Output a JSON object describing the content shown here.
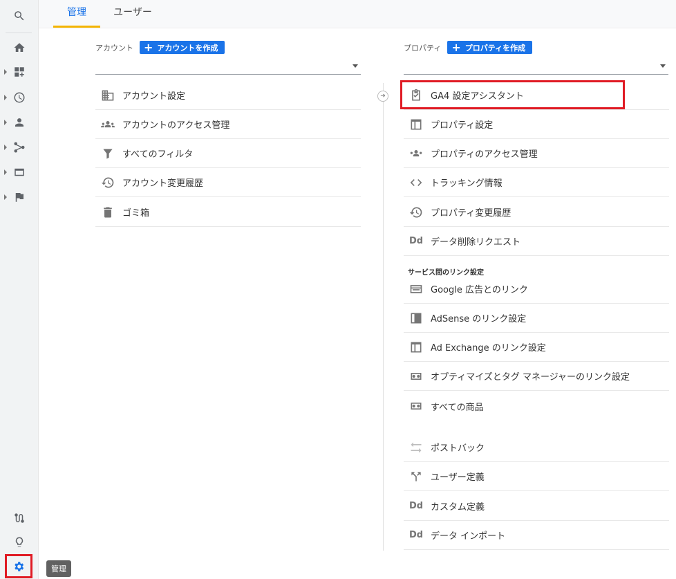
{
  "tabs": [
    {
      "label": "管理",
      "active": true
    },
    {
      "label": "ユーザー",
      "active": false
    }
  ],
  "tooltip": "管理",
  "account": {
    "header_label": "アカウント",
    "create_button": "アカウントを作成",
    "select_value": "",
    "items": [
      {
        "label": "アカウント設定",
        "icon": "building-icon"
      },
      {
        "label": "アカウントのアクセス管理",
        "icon": "people-icon"
      },
      {
        "label": "すべてのフィルタ",
        "icon": "filter-icon"
      },
      {
        "label": "アカウント変更履歴",
        "icon": "history-icon"
      },
      {
        "label": "ゴミ箱",
        "icon": "trash-icon"
      }
    ]
  },
  "property": {
    "header_label": "プロパティ",
    "create_button": "プロパティを作成",
    "select_value": "",
    "items": [
      {
        "label": "GA4 設定アシスタント",
        "icon": "clipboard-check-icon"
      },
      {
        "label": "プロパティ設定",
        "icon": "window-icon"
      },
      {
        "label": "プロパティのアクセス管理",
        "icon": "people-icon"
      },
      {
        "label": "トラッキング情報",
        "icon": "code-icon"
      },
      {
        "label": "プロパティ変更履歴",
        "icon": "history-icon"
      },
      {
        "label": "データ削除リクエスト",
        "icon": "dd-icon",
        "glyph": "Dd"
      }
    ],
    "links_section_title": "サービス間のリンク設定",
    "links": [
      {
        "label": "Google 広告とのリンク",
        "icon": "ads-icon"
      },
      {
        "label": "AdSense のリンク設定",
        "icon": "adsense-icon"
      },
      {
        "label": "Ad Exchange のリンク設定",
        "icon": "window-icon"
      },
      {
        "label": "オプティマイズとタグ マネージャーのリンク設定",
        "icon": "link-icon"
      },
      {
        "label": "すべての商品",
        "icon": "link-icon"
      }
    ],
    "other": [
      {
        "label": "ポストバック",
        "icon": "swap-icon"
      },
      {
        "label": "ユーザー定義",
        "icon": "fork-icon"
      },
      {
        "label": "カスタム定義",
        "icon": "dd-icon",
        "glyph": "Dd"
      },
      {
        "label": "データ インポート",
        "icon": "dd-icon",
        "glyph": "Dd"
      }
    ]
  },
  "colors": {
    "accent": "#1a73e8",
    "highlight": "#e01b24",
    "tab_underline": "#f4b400"
  }
}
